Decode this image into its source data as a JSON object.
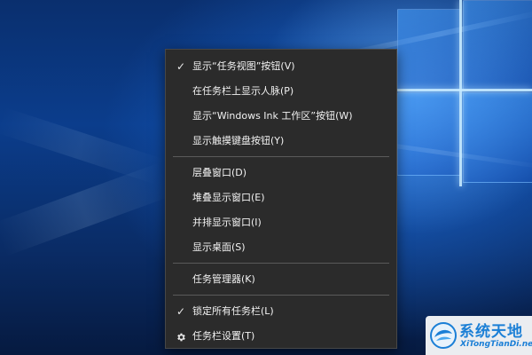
{
  "context_menu": {
    "items_group1": [
      {
        "label": "显示“任务视图”按钮(V)",
        "checked": true
      },
      {
        "label": "在任务栏上显示人脉(P)",
        "checked": false
      },
      {
        "label": "显示“Windows Ink 工作区”按钮(W)",
        "checked": false
      },
      {
        "label": "显示触摸键盘按钮(Y)",
        "checked": false
      }
    ],
    "items_group2": [
      {
        "label": "层叠窗口(D)"
      },
      {
        "label": "堆叠显示窗口(E)"
      },
      {
        "label": "并排显示窗口(I)"
      },
      {
        "label": "显示桌面(S)"
      }
    ],
    "items_group3": [
      {
        "label": "任务管理器(K)"
      }
    ],
    "items_group4": [
      {
        "label": "锁定所有任务栏(L)",
        "checked": true,
        "icon": "checkmark-icon"
      },
      {
        "label": "任务栏设置(T)",
        "icon": "gear-icon"
      }
    ],
    "check_glyph": "✓"
  },
  "watermark": {
    "title": "系统天地",
    "subtitle": "XiTongTianDi.net"
  },
  "colors": {
    "menu_bg": "#2b2b2b",
    "menu_text": "#f2f2f2",
    "separator": "#5a5a5a",
    "watermark_blue": "#1b7fd6"
  }
}
